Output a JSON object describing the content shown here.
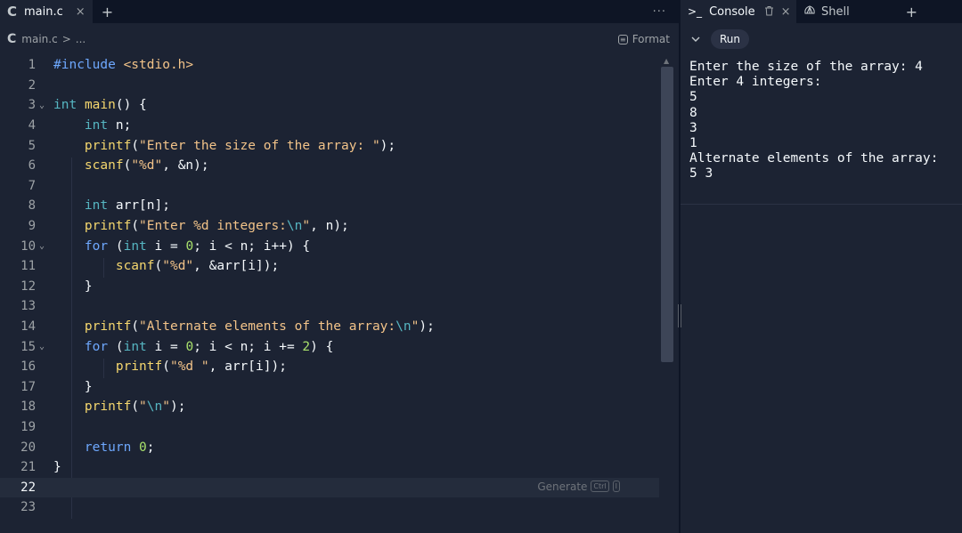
{
  "editor_tabs": {
    "file_tab": "main.c",
    "close_symbol": "×",
    "add_symbol": "+",
    "more_symbol": "···"
  },
  "breadcrumb": {
    "file": "main.c",
    "separator": ">",
    "trail": "..."
  },
  "format_label": "Format",
  "code_lines": [
    {
      "n": "1",
      "html": "<span class=\"pre\">#include</span> <span class=\"inc\">&lt;stdio.h&gt;</span>"
    },
    {
      "n": "2",
      "html": ""
    },
    {
      "n": "3",
      "fold": true,
      "html": "<span class=\"kw\">int</span> <span class=\"fn\">main</span>() {"
    },
    {
      "n": "4",
      "html": "    <span class=\"kw\">int</span> n;"
    },
    {
      "n": "5",
      "html": "    <span class=\"fn\">printf</span>(<span class=\"str\">\"Enter the size of the array: \"</span>);"
    },
    {
      "n": "6",
      "html": "    <span class=\"fn\">scanf</span>(<span class=\"str\">\"%d\"</span>, &amp;n);"
    },
    {
      "n": "7",
      "html": ""
    },
    {
      "n": "8",
      "html": "    <span class=\"kw\">int</span> arr[n];"
    },
    {
      "n": "9",
      "html": "    <span class=\"fn\">printf</span>(<span class=\"str\">\"Enter %d integers:</span><span class=\"esc\">\\n</span><span class=\"str\">\"</span>, n);"
    },
    {
      "n": "10",
      "fold": true,
      "html": "    <span class=\"kw2\">for</span> (<span class=\"kw\">int</span> i = <span class=\"num\">0</span>; i &lt; n; i++) {"
    },
    {
      "n": "11",
      "html": "        <span class=\"fn\">scanf</span>(<span class=\"str\">\"%d\"</span>, &amp;arr[i]);"
    },
    {
      "n": "12",
      "html": "    }"
    },
    {
      "n": "13",
      "html": ""
    },
    {
      "n": "14",
      "html": "    <span class=\"fn\">printf</span>(<span class=\"str\">\"Alternate elements of the array:</span><span class=\"esc\">\\n</span><span class=\"str\">\"</span>);"
    },
    {
      "n": "15",
      "fold": true,
      "html": "    <span class=\"kw2\">for</span> (<span class=\"kw\">int</span> i = <span class=\"num\">0</span>; i &lt; n; i += <span class=\"num\">2</span>) {"
    },
    {
      "n": "16",
      "html": "        <span class=\"fn\">printf</span>(<span class=\"str\">\"%d \"</span>, arr[i]);"
    },
    {
      "n": "17",
      "html": "    }"
    },
    {
      "n": "18",
      "html": "    <span class=\"fn\">printf</span>(<span class=\"str\">\"</span><span class=\"esc\">\\n</span><span class=\"str\">\"</span>);"
    },
    {
      "n": "19",
      "html": ""
    },
    {
      "n": "20",
      "html": "    <span class=\"kw2\">return</span> <span class=\"num\">0</span>;"
    },
    {
      "n": "21",
      "html": "}"
    },
    {
      "n": "22",
      "current": true,
      "html": ""
    },
    {
      "n": "23",
      "html": ""
    }
  ],
  "generate": {
    "label": "Generate",
    "key1": "Ctrl",
    "key2": "I"
  },
  "console_tabs": {
    "console_label": "Console",
    "shell_label": "Shell",
    "prompt_symbol": ">_",
    "close_symbol": "×",
    "add_symbol": "+"
  },
  "run_label": "Run",
  "console_output": "Enter the size of the array: 4\nEnter 4 integers:\n5\n8\n3\n1\nAlternate elements of the array:\n5 3"
}
